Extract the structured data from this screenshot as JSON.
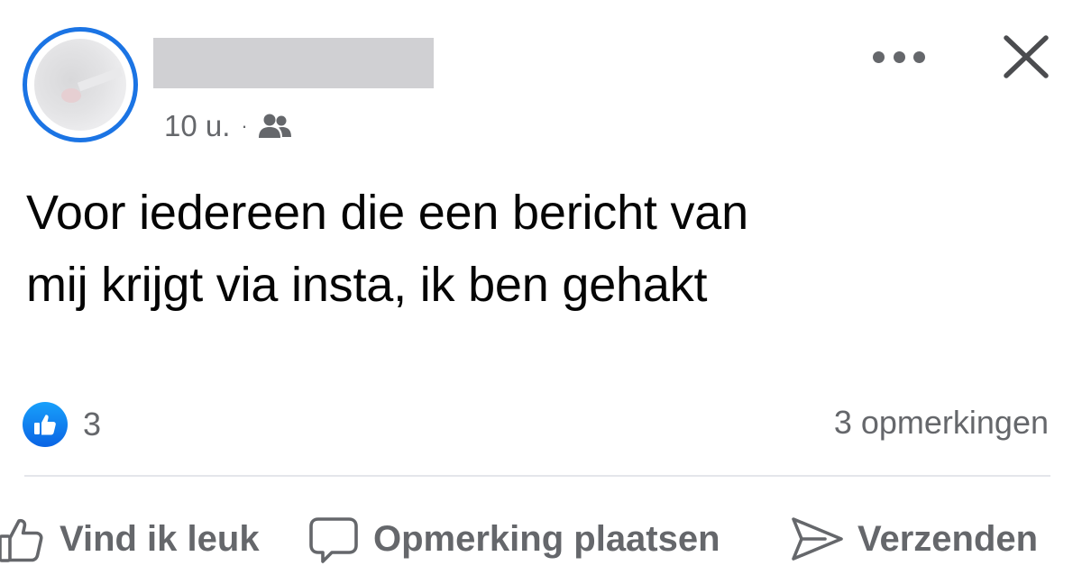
{
  "post": {
    "author_name_redacted": true,
    "timestamp": "10 u.",
    "separator": "·",
    "audience_icon": "friends-icon",
    "text_line1": "Voor iedereen die een bericht van",
    "text_line2": "mij krijgt via insta, ik ben gehakt"
  },
  "header_actions": {
    "more_icon": "more-horizontal-icon",
    "close_icon": "close-icon"
  },
  "stats": {
    "reaction_icon": "like-reaction-icon",
    "reaction_count": "3",
    "comments_label": "3 opmerkingen"
  },
  "actions": {
    "like_label": "Vind ik leuk",
    "comment_label": "Opmerking plaatsen",
    "share_label": "Verzenden"
  },
  "colors": {
    "avatar_ring": "#1b74e4",
    "like_badge": "#0a64e4",
    "secondary_text": "#65676b",
    "primary_text": "#050505"
  }
}
